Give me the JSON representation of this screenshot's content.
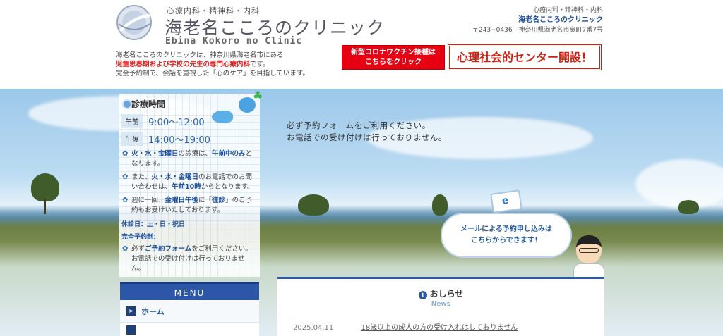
{
  "header": {
    "tagline": "心療内科・精神科・内科",
    "clinic_name": "海老名こころのクリニック",
    "clinic_name_en": "Ebina Kokoro no Clinic",
    "right_specialties": "心療内科・精神科・内科",
    "right_name": "海老名こころのクリニック",
    "right_address": "〒243−0436　神奈川県海老名市扇町7番7号"
  },
  "intro": {
    "line1": "海老名こころのクリニックは、神奈川県海老名市にある",
    "line2_red": "児童思春期および学校の先生の専門心療内科",
    "line2_suffix": "です。",
    "line3": "完全予約制で、会話を重視した「心のケア」を目指しています。"
  },
  "buttons": {
    "covid_line1": "新型コロナワクチン接種は",
    "covid_line2": "こちらをクリック",
    "center": "心理社会的センター開設！"
  },
  "hero": {
    "line1": "必ず予約フォームをご利用ください。",
    "line2": "お電話での受け付けは行っておりません。"
  },
  "schedule": {
    "title": "診療時間",
    "am_label": "午前",
    "am_time": "9:00〜12:00",
    "pm_label": "午後",
    "pm_time": "14:00〜19:00",
    "note1_b": "火・水・金曜日",
    "note1_a": "の診療は、",
    "note1_c": "午前中のみ",
    "note1_d": "となります。",
    "note2_a": "また、",
    "note2_b": "火・水・金曜日",
    "note2_c": "のお電話でのお問い合わせは、",
    "note2_d": "午前10時",
    "note2_e": "からとなります。",
    "note3_a": "週に一回、",
    "note3_b": "金曜日午後",
    "note3_c": "に「",
    "note3_d": "往診",
    "note3_e": "」のご予約もお受けいたしております。",
    "closed": "休診日：土・日・祝日",
    "reservation_label": "完全予約制：",
    "note4_a": "必ず",
    "note4_b": "ご予約フォーム",
    "note4_c": "をご利用ください。お電話での受け付けは行っておりません。"
  },
  "menu": {
    "header": "MENU",
    "item_home": "ホーム"
  },
  "bubble": {
    "line1": "メールによる予約申し込みは",
    "line2": "こちらからできます！",
    "mail_letter": "e"
  },
  "news": {
    "title": "おしらせ",
    "subtitle": "News",
    "items": [
      {
        "date": "2025.04.11",
        "text": "18歳以上の成人の方の受け入れはしておりません"
      }
    ]
  },
  "colors": {
    "brand_blue": "#2c57a8",
    "accent_red": "#e60012",
    "text_blue": "#1d4f9c"
  }
}
